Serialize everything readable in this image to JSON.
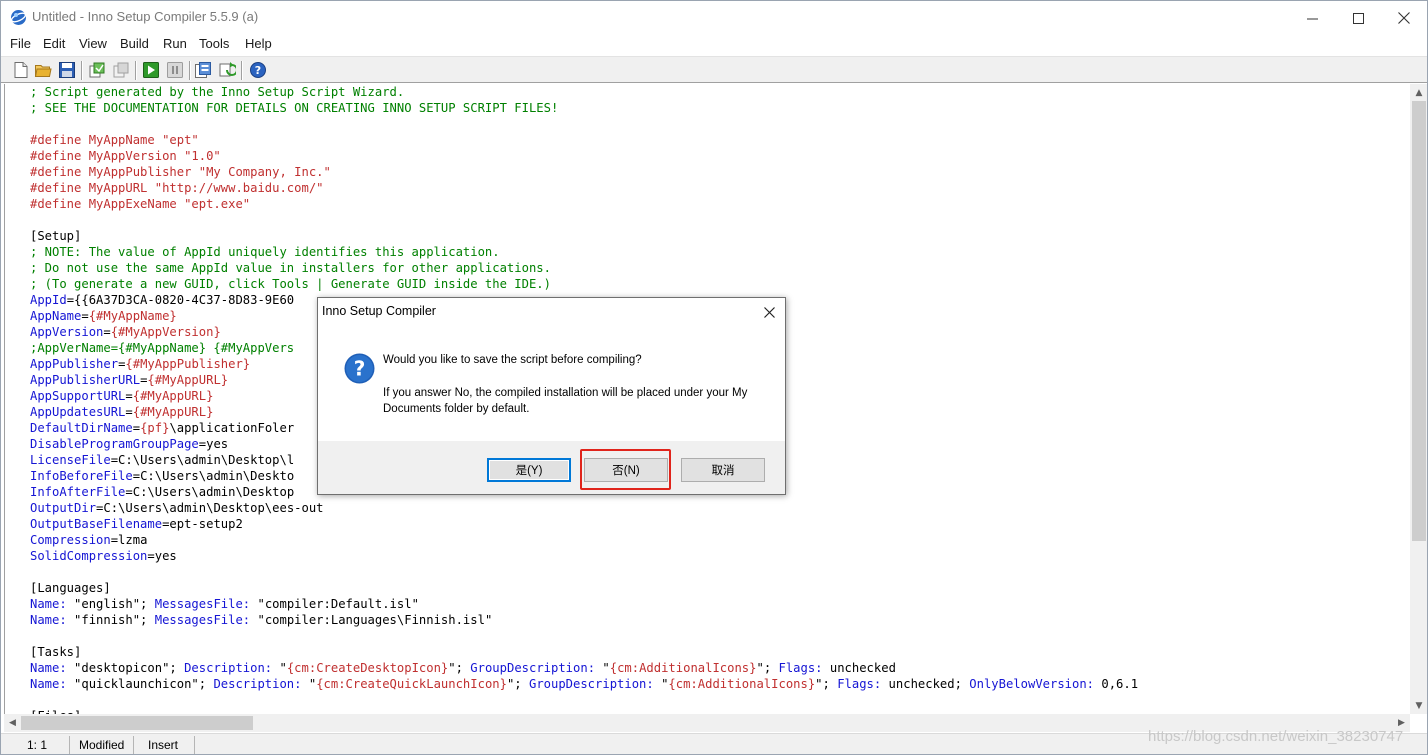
{
  "window": {
    "title": "Untitled - Inno Setup Compiler 5.5.9 (a)",
    "controls": {
      "minimize": "minimize",
      "maximize": "maximize",
      "close": "close"
    }
  },
  "menu": [
    "File",
    "Edit",
    "View",
    "Build",
    "Run",
    "Tools",
    "Help"
  ],
  "toolbar": {
    "icons": [
      "new-file-icon",
      "open-file-icon",
      "save-icon",
      "compile-icon",
      "stop-compile-icon",
      "run-icon",
      "pause-icon",
      "target-setup-icon",
      "refresh-icon",
      "help-icon"
    ]
  },
  "editor": {
    "lines": [
      [
        [
          "c-comment",
          "; Script generated by the Inno Setup Script Wizard."
        ]
      ],
      [
        [
          "c-comment",
          "; SEE THE DOCUMENTATION FOR DETAILS ON CREATING INNO SETUP SCRIPT FILES!"
        ]
      ],
      [],
      [
        [
          "c-define",
          "#define MyAppName \"ept\""
        ]
      ],
      [
        [
          "c-define",
          "#define MyAppVersion \"1.0\""
        ]
      ],
      [
        [
          "c-define",
          "#define MyAppPublisher \"My Company, Inc.\""
        ]
      ],
      [
        [
          "c-define",
          "#define MyAppURL \"http://www.baidu.com/\""
        ]
      ],
      [
        [
          "c-define",
          "#define MyAppExeName \"ept.exe\""
        ]
      ],
      [],
      [
        [
          "c-section",
          "[Setup]"
        ]
      ],
      [
        [
          "c-comment",
          "; NOTE: The value of AppId uniquely identifies this application."
        ]
      ],
      [
        [
          "c-comment",
          "; Do not use the same AppId value in installers for other applications."
        ]
      ],
      [
        [
          "c-comment",
          "; (To generate a new GUID, click Tools | Generate GUID inside the IDE.)"
        ]
      ],
      [
        [
          "c-key",
          "AppId"
        ],
        [
          "c-plain",
          "={{6A37D3CA-0820-4C37-8D83-9E60"
        ]
      ],
      [
        [
          "c-key",
          "AppName"
        ],
        [
          "c-plain",
          "="
        ],
        [
          "c-const",
          "{#MyAppName}"
        ]
      ],
      [
        [
          "c-key",
          "AppVersion"
        ],
        [
          "c-plain",
          "="
        ],
        [
          "c-const",
          "{#MyAppVersion}"
        ]
      ],
      [
        [
          "c-comment",
          ";AppVerName={#MyAppName} {#MyAppVers"
        ]
      ],
      [
        [
          "c-key",
          "AppPublisher"
        ],
        [
          "c-plain",
          "="
        ],
        [
          "c-const",
          "{#MyAppPublisher}"
        ]
      ],
      [
        [
          "c-key",
          "AppPublisherURL"
        ],
        [
          "c-plain",
          "="
        ],
        [
          "c-const",
          "{#MyAppURL}"
        ]
      ],
      [
        [
          "c-key",
          "AppSupportURL"
        ],
        [
          "c-plain",
          "="
        ],
        [
          "c-const",
          "{#MyAppURL}"
        ]
      ],
      [
        [
          "c-key",
          "AppUpdatesURL"
        ],
        [
          "c-plain",
          "="
        ],
        [
          "c-const",
          "{#MyAppURL}"
        ]
      ],
      [
        [
          "c-key",
          "DefaultDirName"
        ],
        [
          "c-plain",
          "="
        ],
        [
          "c-const",
          "{pf}"
        ],
        [
          "c-plain",
          "\\applicationFoler"
        ]
      ],
      [
        [
          "c-key",
          "DisableProgramGroupPage"
        ],
        [
          "c-plain",
          "=yes"
        ]
      ],
      [
        [
          "c-key",
          "LicenseFile"
        ],
        [
          "c-plain",
          "=C:\\Users\\admin\\Desktop\\l"
        ]
      ],
      [
        [
          "c-key",
          "InfoBeforeFile"
        ],
        [
          "c-plain",
          "=C:\\Users\\admin\\Deskto"
        ]
      ],
      [
        [
          "c-key",
          "InfoAfterFile"
        ],
        [
          "c-plain",
          "=C:\\Users\\admin\\Desktop"
        ]
      ],
      [
        [
          "c-key",
          "OutputDir"
        ],
        [
          "c-plain",
          "=C:\\Users\\admin\\Desktop\\ees-out"
        ]
      ],
      [
        [
          "c-key",
          "OutputBaseFilename"
        ],
        [
          "c-plain",
          "=ept-setup2"
        ]
      ],
      [
        [
          "c-key",
          "Compression"
        ],
        [
          "c-plain",
          "=lzma"
        ]
      ],
      [
        [
          "c-key",
          "SolidCompression"
        ],
        [
          "c-plain",
          "=yes"
        ]
      ],
      [],
      [
        [
          "c-section",
          "[Languages]"
        ]
      ],
      [
        [
          "c-key",
          "Name:"
        ],
        [
          "c-plain",
          " \"english\"; "
        ],
        [
          "c-key",
          "MessagesFile:"
        ],
        [
          "c-plain",
          " \"compiler:Default.isl\""
        ]
      ],
      [
        [
          "c-key",
          "Name:"
        ],
        [
          "c-plain",
          " \"finnish\"; "
        ],
        [
          "c-key",
          "MessagesFile:"
        ],
        [
          "c-plain",
          " \"compiler:Languages\\Finnish.isl\""
        ]
      ],
      [],
      [
        [
          "c-section",
          "[Tasks]"
        ]
      ],
      [
        [
          "c-key",
          "Name:"
        ],
        [
          "c-plain",
          " \"desktopicon\"; "
        ],
        [
          "c-key",
          "Description:"
        ],
        [
          "c-plain",
          " \""
        ],
        [
          "c-const",
          "{cm:CreateDesktopIcon}"
        ],
        [
          "c-plain",
          "\"; "
        ],
        [
          "c-key",
          "GroupDescription:"
        ],
        [
          "c-plain",
          " \""
        ],
        [
          "c-const",
          "{cm:AdditionalIcons}"
        ],
        [
          "c-plain",
          "\"; "
        ],
        [
          "c-key",
          "Flags:"
        ],
        [
          "c-plain",
          " unchecked"
        ]
      ],
      [
        [
          "c-key",
          "Name:"
        ],
        [
          "c-plain",
          " \"quicklaunchicon\"; "
        ],
        [
          "c-key",
          "Description:"
        ],
        [
          "c-plain",
          " \""
        ],
        [
          "c-const",
          "{cm:CreateQuickLaunchIcon}"
        ],
        [
          "c-plain",
          "\"; "
        ],
        [
          "c-key",
          "GroupDescription:"
        ],
        [
          "c-plain",
          " \""
        ],
        [
          "c-const",
          "{cm:AdditionalIcons}"
        ],
        [
          "c-plain",
          "\"; "
        ],
        [
          "c-key",
          "Flags:"
        ],
        [
          "c-plain",
          " unchecked; "
        ],
        [
          "c-key",
          "OnlyBelowVersion:"
        ],
        [
          "c-plain",
          " 0,6.1"
        ]
      ],
      [],
      [
        [
          "c-section",
          "[Files]"
        ]
      ]
    ]
  },
  "status": {
    "position": "1:   1",
    "modified": "Modified",
    "mode": "Insert"
  },
  "watermark": "https://blog.csdn.net/weixin_38230747",
  "dialog": {
    "title": "Inno Setup Compiler",
    "question": "Would you like to save the script before compiling?",
    "detail": "If you answer No, the compiled installation will be placed under your My Documents folder by default.",
    "buttons": {
      "yes": "是(Y)",
      "no": "否(N)",
      "cancel": "取消"
    },
    "highlight_color": "#e0241b"
  },
  "colors": {
    "comment": "#008000",
    "define": "#c03030",
    "keyword": "#1515d4",
    "accent": "#0078d7"
  }
}
